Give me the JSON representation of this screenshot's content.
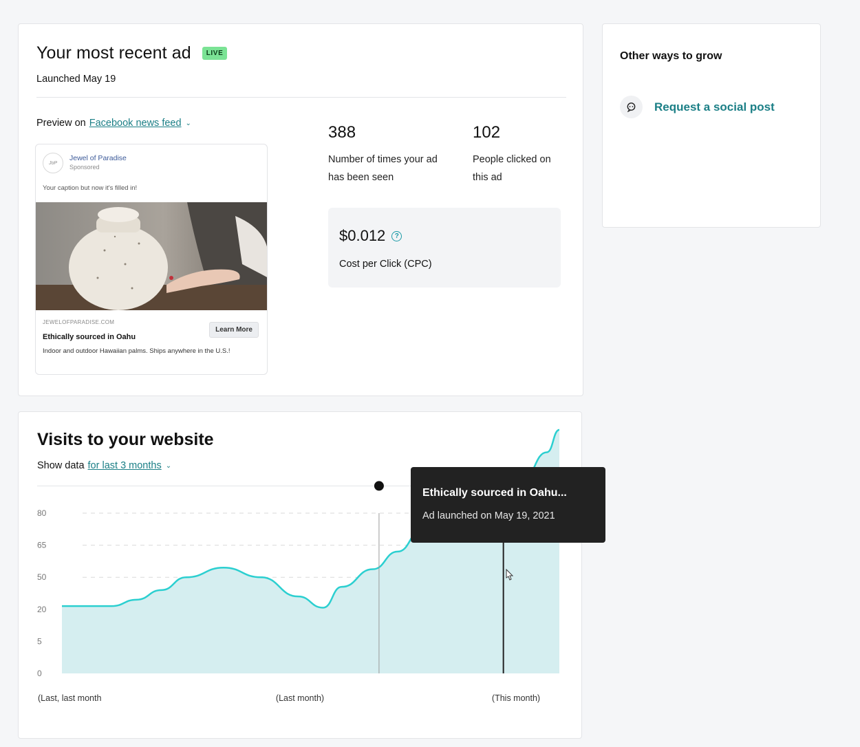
{
  "ad": {
    "title": "Your most recent ad",
    "badge": "LIVE",
    "launched": "Launched May 19",
    "preview_prefix": "Preview on",
    "preview_link": "Facebook news feed",
    "fb": {
      "page_name": "Jewel of Paradise",
      "sponsored": "Sponsored",
      "caption": "Your caption but now it's filled in!",
      "domain": "JEWELOFPARADISE.COM",
      "headline": "Ethically sourced in Oahu",
      "description": "Indoor and outdoor Hawaiian palms. Ships anywhere in the U.S.!",
      "cta": "Learn More"
    },
    "stats": [
      {
        "value": "388",
        "label": "Number of times your ad has been seen"
      },
      {
        "value": "102",
        "label": "People clicked on this ad"
      }
    ],
    "cpc": {
      "value": "$0.012",
      "label": "Cost per Click (CPC)"
    }
  },
  "grow": {
    "title": "Other ways to grow",
    "item_label": "Request a social post"
  },
  "visits": {
    "title": "Visits to your website",
    "show_prefix": "Show data",
    "range_link": "for last 3 months",
    "tooltip": {
      "title": "Ethically sourced in Oahu...",
      "subtitle": "Ad launched on May 19, 2021"
    }
  },
  "chart_data": {
    "type": "area",
    "title": "",
    "xlabel": "",
    "ylabel": "",
    "y_ticks": [
      "80",
      "65",
      "50",
      "20",
      "5",
      "0"
    ],
    "x_labels": [
      "(Last, last month",
      "(Last month)",
      "(This month)"
    ],
    "points": [
      {
        "x": 0,
        "y": 2.1
      },
      {
        "x": 4,
        "y": 2.1
      },
      {
        "x": 8,
        "y": 2.1
      },
      {
        "x": 12,
        "y": 2.3
      },
      {
        "x": 16,
        "y": 2.6
      },
      {
        "x": 20,
        "y": 3.0
      },
      {
        "x": 26,
        "y": 3.3
      },
      {
        "x": 32,
        "y": 3.0
      },
      {
        "x": 38,
        "y": 2.4
      },
      {
        "x": 42,
        "y": 2.05
      },
      {
        "x": 45,
        "y": 2.7
      },
      {
        "x": 50,
        "y": 3.25
      },
      {
        "x": 54,
        "y": 3.8
      },
      {
        "x": 58,
        "y": 4.5
      },
      {
        "x": 62,
        "y": 4.55
      },
      {
        "x": 66,
        "y": 4.3
      },
      {
        "x": 70,
        "y": 4.9
      },
      {
        "x": 74,
        "y": 6.0
      },
      {
        "x": 78,
        "y": 6.9
      },
      {
        "x": 80,
        "y": 7.6
      }
    ],
    "markers": [
      {
        "x": 51,
        "y": 5.85
      },
      {
        "x": 71,
        "y": 5.85
      }
    ],
    "grid": true,
    "colors": {
      "line": "#2bcfd0",
      "fill": "#d5eef0",
      "marker": "#111111"
    }
  }
}
